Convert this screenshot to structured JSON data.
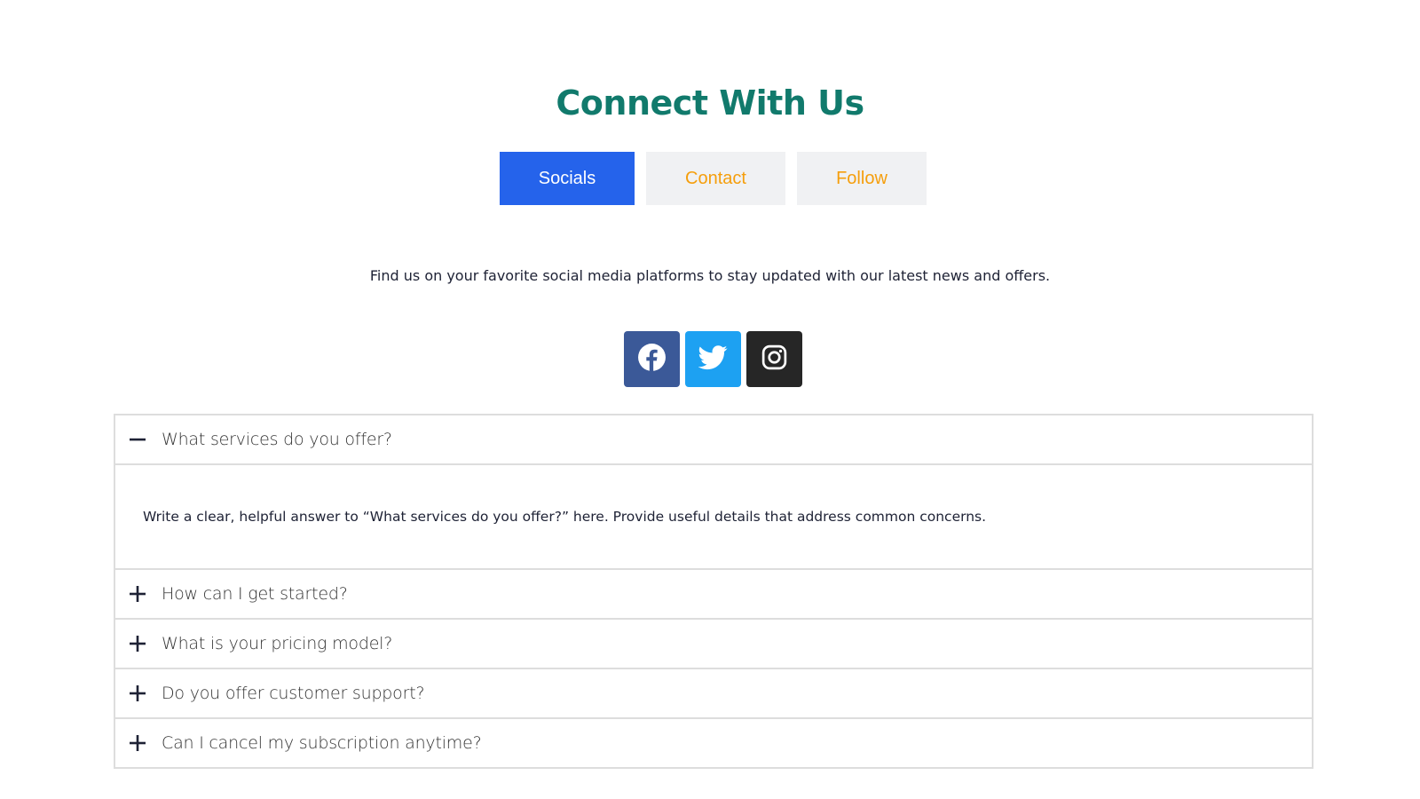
{
  "header": {
    "title": "Connect With Us"
  },
  "tabs": [
    {
      "label": "Socials",
      "active": true
    },
    {
      "label": "Contact",
      "active": false
    },
    {
      "label": "Follow",
      "active": false
    }
  ],
  "tagline": "Find us on your favorite social media platforms to stay updated with our latest news and offers.",
  "social": [
    {
      "icon": "facebook-icon",
      "color": "#3b5998"
    },
    {
      "icon": "twitter-icon",
      "color": "#1da1f2"
    },
    {
      "icon": "instagram-icon",
      "color": "#262626"
    }
  ],
  "faq": {
    "items": [
      {
        "question": "What services do you offer?",
        "expanded": true,
        "answer": "Write a clear, helpful answer to “What services do you offer?” here. Provide useful details that address common concerns."
      },
      {
        "question": "How can I get started?",
        "expanded": false
      },
      {
        "question": "What is your pricing model?",
        "expanded": false
      },
      {
        "question": "Do you offer customer support?",
        "expanded": false
      },
      {
        "question": "Can I cancel my subscription anytime?",
        "expanded": false
      }
    ]
  },
  "colors": {
    "title": "#117a6c",
    "tab_active_bg": "#2563eb",
    "tab_active_text": "#ffffff",
    "tab_inactive_bg": "#f0f1f3",
    "tab_inactive_text": "#f59e0b",
    "text_dark": "#1e2235"
  }
}
